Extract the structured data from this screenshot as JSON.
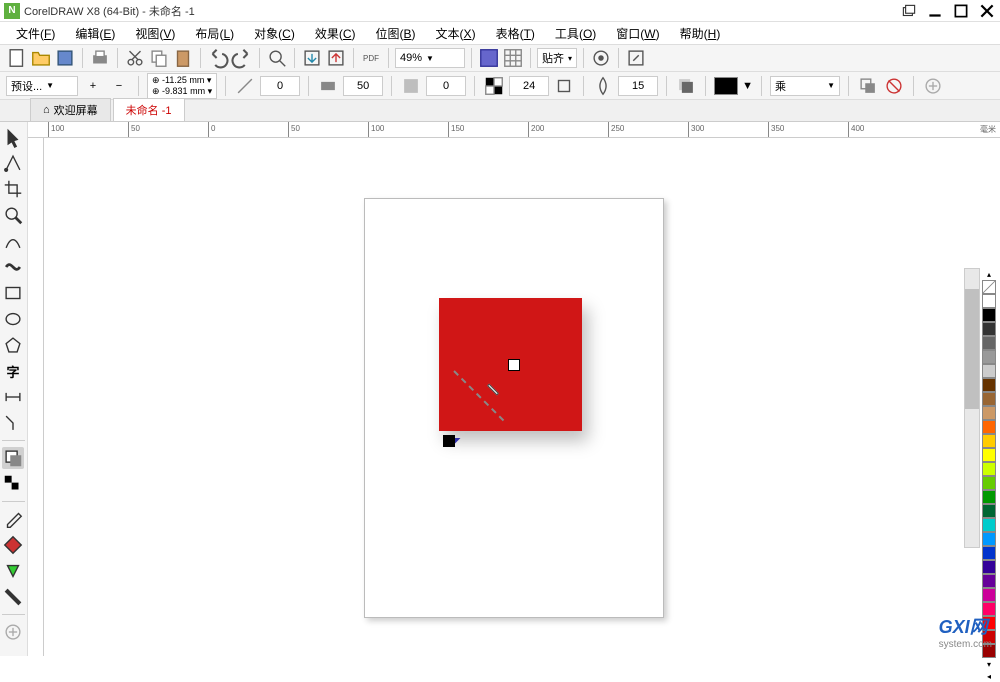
{
  "titlebar": {
    "app_name": "CorelDRAW X8 (64-Bit)",
    "doc_name": "未命名 -1"
  },
  "menubar": {
    "items": [
      {
        "label": "文件",
        "key": "F"
      },
      {
        "label": "编辑",
        "key": "E"
      },
      {
        "label": "视图",
        "key": "V"
      },
      {
        "label": "布局",
        "key": "L"
      },
      {
        "label": "对象",
        "key": "C"
      },
      {
        "label": "效果",
        "key": "C"
      },
      {
        "label": "位图",
        "key": "B"
      },
      {
        "label": "文本",
        "key": "X"
      },
      {
        "label": "表格",
        "key": "T"
      },
      {
        "label": "工具",
        "key": "O"
      },
      {
        "label": "窗口",
        "key": "W"
      },
      {
        "label": "帮助",
        "key": "H"
      }
    ]
  },
  "toolbar1": {
    "zoom": "49%",
    "snap_label": "贴齐"
  },
  "toolbar2": {
    "preset": "预设...",
    "x_coord": "-11.25 mm",
    "y_coord": "-9.831 mm",
    "rotation": "0",
    "shadow_opacity": "50",
    "feather": "0",
    "val1": "24",
    "val2": "15",
    "blend_mode": "乘"
  },
  "tabs": {
    "welcome": "欢迎屏幕",
    "doc": "未命名 -1"
  },
  "ruler": {
    "ticks_h": [
      "100",
      "50",
      "0",
      "50",
      "100",
      "150",
      "200",
      "250",
      "300",
      "350",
      "400"
    ],
    "unit": "毫米"
  },
  "palette_colors": [
    "#ffffff",
    "#000000",
    "#333333",
    "#666666",
    "#999999",
    "#cccccc",
    "#663300",
    "#996633",
    "#cc9966",
    "#ff6600",
    "#ffcc00",
    "#ffff00",
    "#ccff00",
    "#66cc00",
    "#009900",
    "#006633",
    "#00cccc",
    "#0099ff",
    "#0033cc",
    "#330099",
    "#660099",
    "#cc0099",
    "#ff0066",
    "#ff0000",
    "#cc0000",
    "#990000"
  ],
  "watermark": {
    "logo": "GXI网",
    "url": "system.com"
  }
}
